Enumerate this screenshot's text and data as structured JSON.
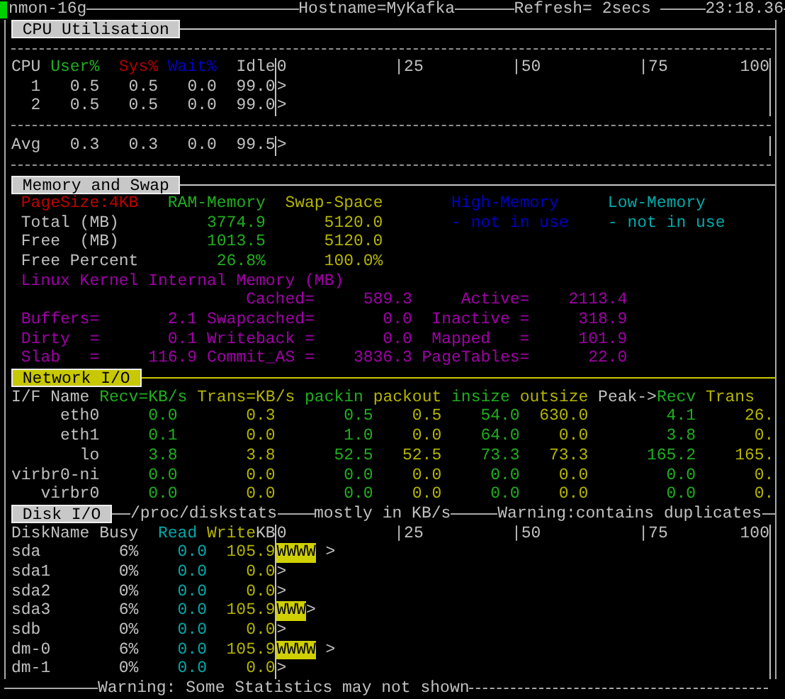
{
  "header": {
    "program": "nmon-16g",
    "hostname": "Hostname=MyKafka",
    "refresh": "Refresh= 2secs",
    "time": "23:18.36"
  },
  "cpu": {
    "title": "CPU Utilisation",
    "color": "#c8c8c8",
    "columns": [
      {
        "label": "CPU",
        "color": "#c0c0c0"
      },
      {
        "label": "User%",
        "color": "#1fae1f"
      },
      {
        "label": "Sys%",
        "color": "#b00000"
      },
      {
        "label": "Wait%",
        "color": "#0000c8"
      },
      {
        "label": "Idle",
        "color": "#c0c0c0"
      }
    ],
    "scale": [
      "0",
      "|25",
      "|50",
      "|75",
      "100"
    ],
    "rows": [
      {
        "cpu": "1",
        "values": [
          "0.5",
          "0.5",
          "0.0",
          "99.0"
        ],
        "bar": ">"
      },
      {
        "cpu": "2",
        "values": [
          "0.5",
          "0.5",
          "0.0",
          "99.0"
        ],
        "bar": ">"
      }
    ],
    "average": {
      "label": "Avg",
      "values": [
        "0.3",
        "0.3",
        "0.0",
        "99.5"
      ],
      "bar": ">"
    }
  },
  "memory": {
    "title": "Memory and Swap",
    "color": "#c8c8c8",
    "page_size": "PageSize:4KB",
    "columns": [
      {
        "label": "RAM-Memory",
        "color": "#1fae1f"
      },
      {
        "label": "Swap-Space",
        "color": "#b4b400"
      },
      {
        "label": "High-Memory",
        "color": "#0000c8"
      },
      {
        "label": "Low-Memory",
        "color": "#00aaaa"
      }
    ],
    "rows": [
      {
        "label": "Total (MB)",
        "values": [
          "3774.9",
          "5120.0",
          "- not in use",
          "- not in use"
        ]
      },
      {
        "label": "Free  (MB)",
        "values": [
          "1013.5",
          "5120.0"
        ]
      },
      {
        "label": "Free Percent",
        "values": [
          "26.8%",
          "100.0%"
        ]
      }
    ],
    "kernel_title": "Linux Kernel Internal Memory (MB)",
    "kernel_rows": [
      {
        "middle": {
          "label": "Cached=",
          "value": "589.3"
        },
        "right": {
          "label": "Active=",
          "value": "2113.4"
        }
      },
      {
        "left": {
          "label": "Buffers=",
          "value": "2.1"
        },
        "middle": {
          "label": "Swapcached=",
          "value": "0.0"
        },
        "right": {
          "label": "Inactive =",
          "value": "318.9"
        }
      },
      {
        "left": {
          "label": "Dirty  =",
          "value": "0.1"
        },
        "middle": {
          "label": "Writeback =",
          "value": "0.0"
        },
        "right": {
          "label": "Mapped   =",
          "value": "101.9"
        }
      },
      {
        "left": {
          "label": "Slab   =",
          "value": "116.9"
        },
        "middle": {
          "label": "Commit_AS =",
          "value": "3836.3"
        },
        "right": {
          "label": "PageTables=",
          "value": "22.0"
        }
      }
    ]
  },
  "network": {
    "title": "Network I/O",
    "color": "#c8c800",
    "name_header": "I/F Name",
    "columns": [
      {
        "label": "Recv=KB/s",
        "color": "#1fae1f"
      },
      {
        "label": "Trans=KB/s",
        "color": "#b4b400"
      },
      {
        "label": "packin",
        "color": "#1fae1f"
      },
      {
        "label": "packout",
        "color": "#b4b400"
      },
      {
        "label": "insize",
        "color": "#1fae1f"
      },
      {
        "label": "outsize",
        "color": "#b4b400"
      },
      {
        "prefix": "Peak->",
        "label": "Recv",
        "color": "#1fae1f"
      },
      {
        "label": "Trans",
        "color": "#b4b400"
      }
    ],
    "rows": [
      {
        "name": "eth0",
        "values": [
          "0.0",
          "0.3",
          "0.5",
          "0.5",
          "54.0",
          "630.0",
          "4.1",
          "26."
        ]
      },
      {
        "name": "eth1",
        "values": [
          "0.1",
          "0.0",
          "1.0",
          "0.0",
          "64.0",
          "0.0",
          "3.8",
          "0."
        ]
      },
      {
        "name": "lo",
        "values": [
          "3.8",
          "3.8",
          "52.5",
          "52.5",
          "73.3",
          "73.3",
          "165.2",
          "165."
        ]
      },
      {
        "name": "virbr0-ni",
        "values": [
          "0.0",
          "0.0",
          "0.0",
          "0.0",
          "0.0",
          "0.0",
          "0.0",
          "0."
        ]
      },
      {
        "name": "virbr0",
        "values": [
          "0.0",
          "0.0",
          "0.0",
          "0.0",
          "0.0",
          "0.0",
          "0.0",
          "0."
        ]
      }
    ]
  },
  "disk": {
    "title": "Disk I/O",
    "color": "#c8c8c8",
    "notes": [
      "/proc/diskstats",
      "mostly in KB/s",
      "Warning:contains duplicates"
    ],
    "headers": {
      "name": "DiskName",
      "busy": "Busy",
      "read": "Read",
      "write": "Write",
      "unit": "KB"
    },
    "scale": [
      "0",
      "|25",
      "|50",
      "|75",
      "100"
    ],
    "rows": [
      {
        "name": "sda",
        "busy": "6%",
        "read": "0.0",
        "write": "105.9",
        "bar": "WWWW",
        "marker": ">",
        "spaced": true
      },
      {
        "name": "sda1",
        "busy": "0%",
        "read": "0.0",
        "write": "0.0",
        "marker": ">"
      },
      {
        "name": "sda2",
        "busy": "0%",
        "read": "0.0",
        "write": "0.0",
        "marker": ">"
      },
      {
        "name": "sda3",
        "busy": "6%",
        "read": "0.0",
        "write": "105.9",
        "bar": "WWW",
        "marker": ">",
        "spaced": false
      },
      {
        "name": "sdb",
        "busy": "0%",
        "read": "0.0",
        "write": "0.0",
        "marker": ">"
      },
      {
        "name": "dm-0",
        "busy": "6%",
        "read": "0.0",
        "write": "105.9",
        "bar": "WWWW",
        "marker": ">",
        "spaced": true
      },
      {
        "name": "dm-1",
        "busy": "0%",
        "read": "0.0",
        "write": "0.0",
        "marker": ">"
      }
    ]
  },
  "footer": "Warning: Some Statistics may not shown"
}
